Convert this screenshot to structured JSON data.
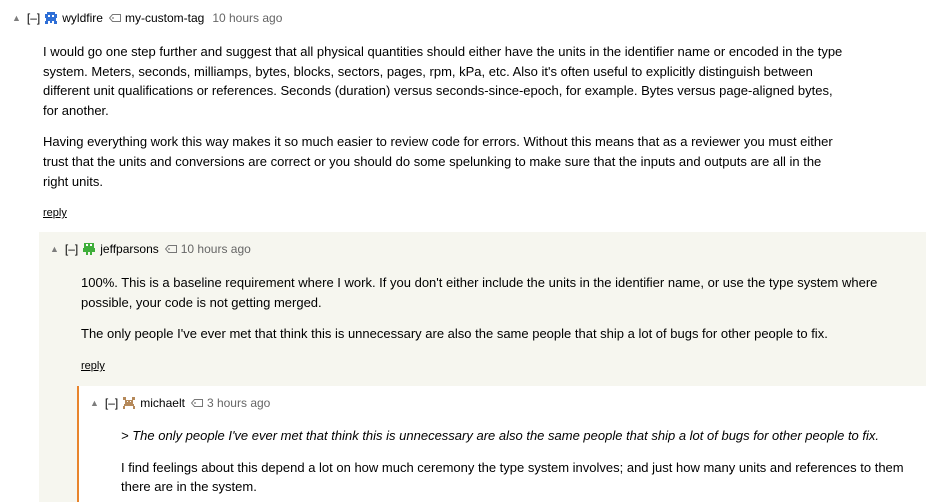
{
  "comments": [
    {
      "vote_glyph": "▲",
      "toggle": "[–]",
      "avatar": "blue-invader-avatar",
      "user": "wyldfire",
      "tag_icon": "tag-icon",
      "tag": "my-custom-tag",
      "age": "10 hours ago",
      "paragraphs": [
        "I would go one step further and suggest that all physical quantities should either have the units in the identifier name or encoded in the type system. Meters, seconds, milliamps, bytes, blocks, sectors, pages, rpm, kPa, etc. Also it's often useful to explicitly distinguish between different unit qualifications or references. Seconds (duration) versus seconds-since-epoch, for example. Bytes versus page-aligned bytes, for another.",
        "Having everything work this way makes it so much easier to review code for errors. Without this means that as a reviewer you must either trust that the units and conversions are correct or you should do some spelunking to make sure that the inputs and outputs are all in the right units."
      ],
      "reply": "reply"
    },
    {
      "vote_glyph": "▲",
      "toggle": "[–]",
      "avatar": "green-robot-avatar",
      "user": "jeffparsons",
      "tag_icon": "tag-icon",
      "age": "10 hours ago",
      "paragraphs": [
        "100%. This is a baseline requirement where I work. If you don't either include the units in the identifier name, or use the type system where possible, your code is not getting merged.",
        "The only people I've ever met that think this is unnecessary are also the same people that ship a lot of bugs for other people to fix."
      ],
      "reply": "reply"
    },
    {
      "vote_glyph": "▲",
      "toggle": "[–]",
      "avatar": "brown-creature-avatar",
      "user": "michaelt",
      "tag_icon": "tag-icon",
      "age": "3 hours ago",
      "quote": "> The only people I've ever met that think this is unnecessary are also the same people that ship a lot of bugs for other people to fix.",
      "paragraphs": [
        "I find feelings about this depend a lot on how much ceremony the type system involves; and just how many units and references to them there are in the system."
      ]
    }
  ],
  "colors": {
    "thread_bg": "#f6f6ef",
    "indent_bar": "#e8842c",
    "meta_gray": "#666666"
  }
}
